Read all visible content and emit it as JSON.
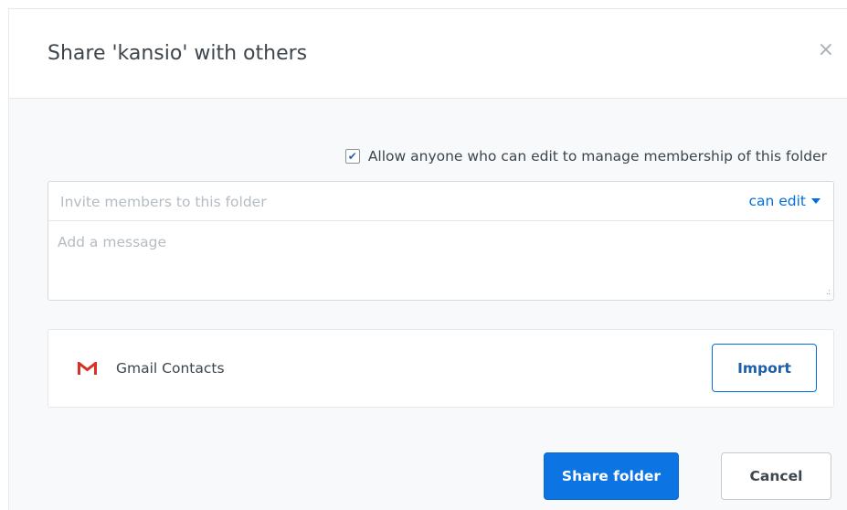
{
  "dialog": {
    "title": "Share 'kansio' with others",
    "close_label": "×"
  },
  "manage_membership": {
    "checked": true,
    "label": "Allow anyone who can edit to manage membership of this folder"
  },
  "invite": {
    "placeholder": "Invite members to this folder",
    "value": "",
    "permission": "can edit",
    "message_placeholder": "Add a message",
    "message_value": ""
  },
  "contacts": {
    "icon": "gmail-icon",
    "label": "Gmail Contacts",
    "import_label": "Import"
  },
  "actions": {
    "share_label": "Share folder",
    "cancel_label": "Cancel"
  },
  "colors": {
    "accent": "#0d74e3",
    "link": "#0070e0",
    "gmail_red": "#d93025",
    "background": "#f7f9fa"
  }
}
